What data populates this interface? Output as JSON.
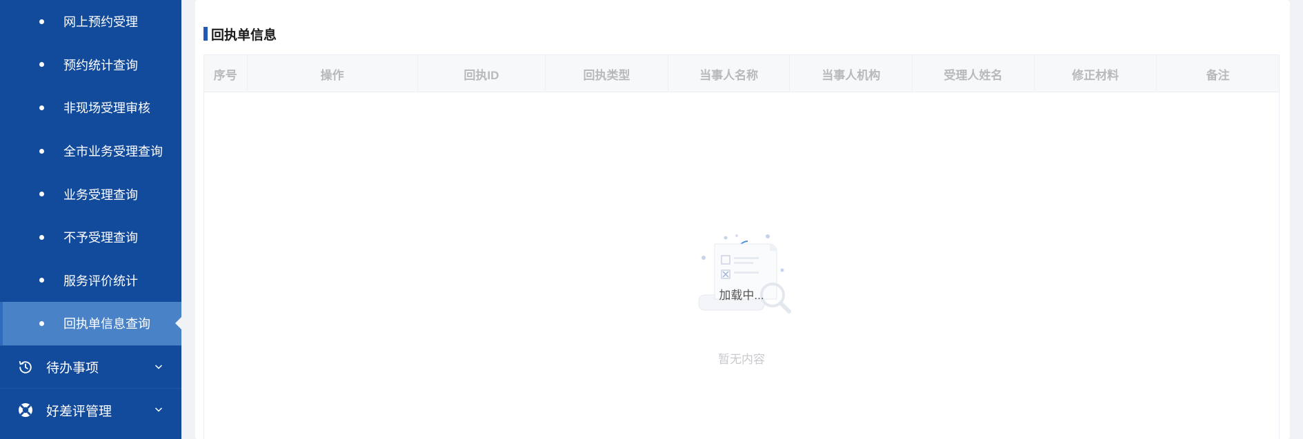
{
  "sidebar": {
    "sub_items": [
      {
        "label": "网上预约受理"
      },
      {
        "label": "预约统计查询"
      },
      {
        "label": "非现场受理审核"
      },
      {
        "label": "全市业务受理查询"
      },
      {
        "label": "业务受理查询"
      },
      {
        "label": "不予受理查询"
      },
      {
        "label": "服务评价统计"
      },
      {
        "label": "回执单信息查询",
        "active": true
      }
    ],
    "menu_items": [
      {
        "label": "待办事项",
        "icon": "clock-history-icon"
      },
      {
        "label": "好差评管理",
        "icon": "lifebuoy-icon"
      }
    ]
  },
  "main": {
    "section_title": "回执单信息",
    "table": {
      "columns": [
        "序号",
        "操作",
        "回执ID",
        "回执类型",
        "当事人名称",
        "当事人机构",
        "受理人姓名",
        "修正材料",
        "备注"
      ],
      "rows": []
    },
    "loading_text": "加载中...",
    "empty_text": "暂无内容"
  },
  "colors": {
    "sidebar_bg": "#124a9c",
    "sidebar_active_bg": "#4a82c8",
    "accent": "#1f5bb5",
    "page_bg": "#f0f2f5"
  }
}
